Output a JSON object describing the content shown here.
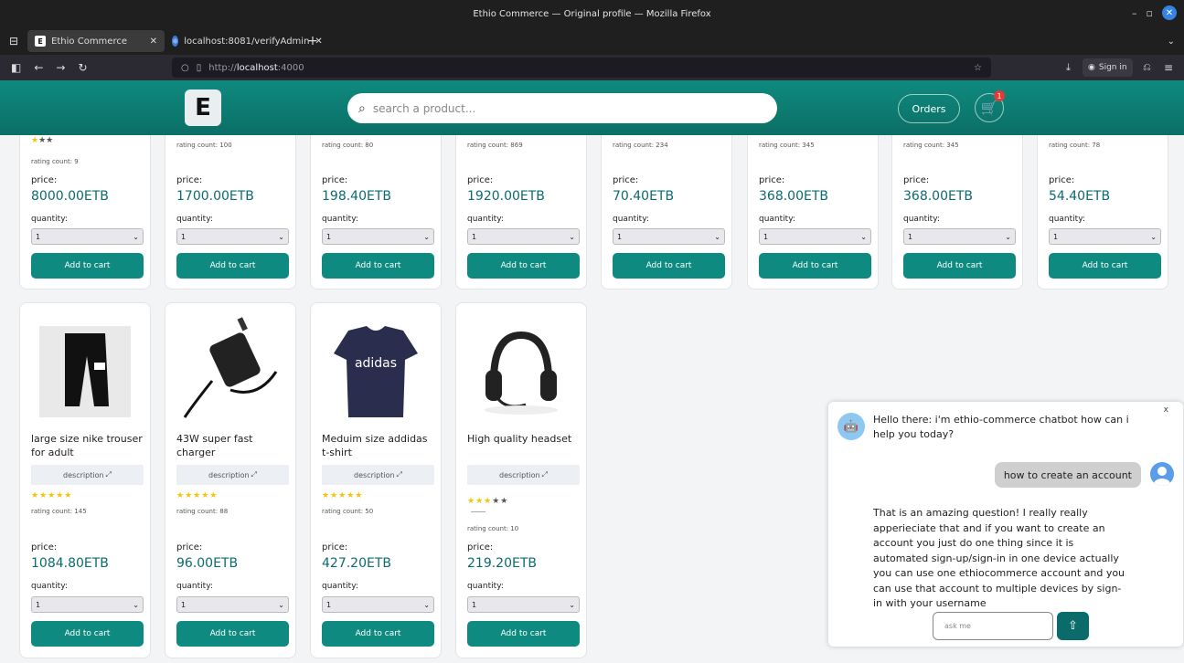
{
  "window": {
    "title": "Ethio Commerce — Original profile — Mozilla Firefox"
  },
  "tabs": [
    {
      "label": "Ethio Commerce"
    },
    {
      "label": "localhost:8081/verifyAdmin"
    }
  ],
  "nav": {
    "url_prefix": "http://",
    "url_host": "localhost",
    "url_port": ":4000",
    "sign_in": "Sign in"
  },
  "header": {
    "logo": "E",
    "search_placeholder": "search a product...",
    "orders": "Orders",
    "cart_count": "1"
  },
  "top_products": [
    {
      "rating_count": "rating count: 9",
      "price_label": "price:",
      "price": "8000.00ETB",
      "qty_label": "quantity:",
      "qty": "1",
      "btn": "Add to cart"
    },
    {
      "rating_count": "rating count: 100",
      "price_label": "price:",
      "price": "1700.00ETB",
      "qty_label": "quantity:",
      "qty": "1",
      "btn": "Add to cart"
    },
    {
      "rating_count": "rating count: 80",
      "price_label": "price:",
      "price": "198.40ETB",
      "qty_label": "quantity:",
      "qty": "1",
      "btn": "Add to cart"
    },
    {
      "rating_count": "rating count: 869",
      "price_label": "price:",
      "price": "1920.00ETB",
      "qty_label": "quantity:",
      "qty": "1",
      "btn": "Add to cart"
    },
    {
      "rating_count": "rating count: 234",
      "price_label": "price:",
      "price": "70.40ETB",
      "qty_label": "quantity:",
      "qty": "1",
      "btn": "Add to cart"
    },
    {
      "rating_count": "rating count: 345",
      "price_label": "price:",
      "price": "368.00ETB",
      "qty_label": "quantity:",
      "qty": "1",
      "btn": "Add to cart"
    },
    {
      "rating_count": "rating count: 345",
      "price_label": "price:",
      "price": "368.00ETB",
      "qty_label": "quantity:",
      "qty": "1",
      "btn": "Add to cart"
    },
    {
      "rating_count": "rating count: 78",
      "price_label": "price:",
      "price": "54.40ETB",
      "qty_label": "quantity:",
      "qty": "1",
      "btn": "Add to cart"
    }
  ],
  "bottom_products": [
    {
      "name": "large size nike trouser for adult",
      "desc": "description",
      "stars": "★★★★★",
      "rating_count": "rating count: 145",
      "price_label": "price:",
      "price": "1084.80ETB",
      "qty_label": "quantity:",
      "qty": "1",
      "btn": "Add to cart"
    },
    {
      "name": "43W super fast charger",
      "desc": "description",
      "stars": "★★★★★",
      "rating_count": "rating count: 88",
      "price_label": "price:",
      "price": "96.00ETB",
      "qty_label": "quantity:",
      "qty": "1",
      "btn": "Add to cart"
    },
    {
      "name": "Meduim size addidas t-shirt",
      "desc": "description",
      "stars": "★★★★★",
      "rating_count": "rating count: 50",
      "price_label": "price:",
      "price": "427.20ETB",
      "qty_label": "quantity:",
      "qty": "1",
      "btn": "Add to cart"
    },
    {
      "name": "High quality headset",
      "desc": "description",
      "stars": "★★★",
      "stars_off": "★★",
      "rating_count": "rating count: 10",
      "price_label": "price:",
      "price": "219.20ETB",
      "qty_label": "quantity:",
      "qty": "1",
      "btn": "Add to cart"
    }
  ],
  "chat": {
    "close": "x",
    "bot_greeting": "Hello there: i'm ethio-commerce chatbot how can i help you today?",
    "user_message": "how to create an account",
    "bot_reply": "That is an amazing question! I really really apperieciate that and if you want to create an account you just do one thing since it is automated sign-up/sign-in in one device actually you can use one ethiocommerce account and you can use that account to multiple devices by sign-in with your username",
    "input_placeholder": "ask me"
  }
}
